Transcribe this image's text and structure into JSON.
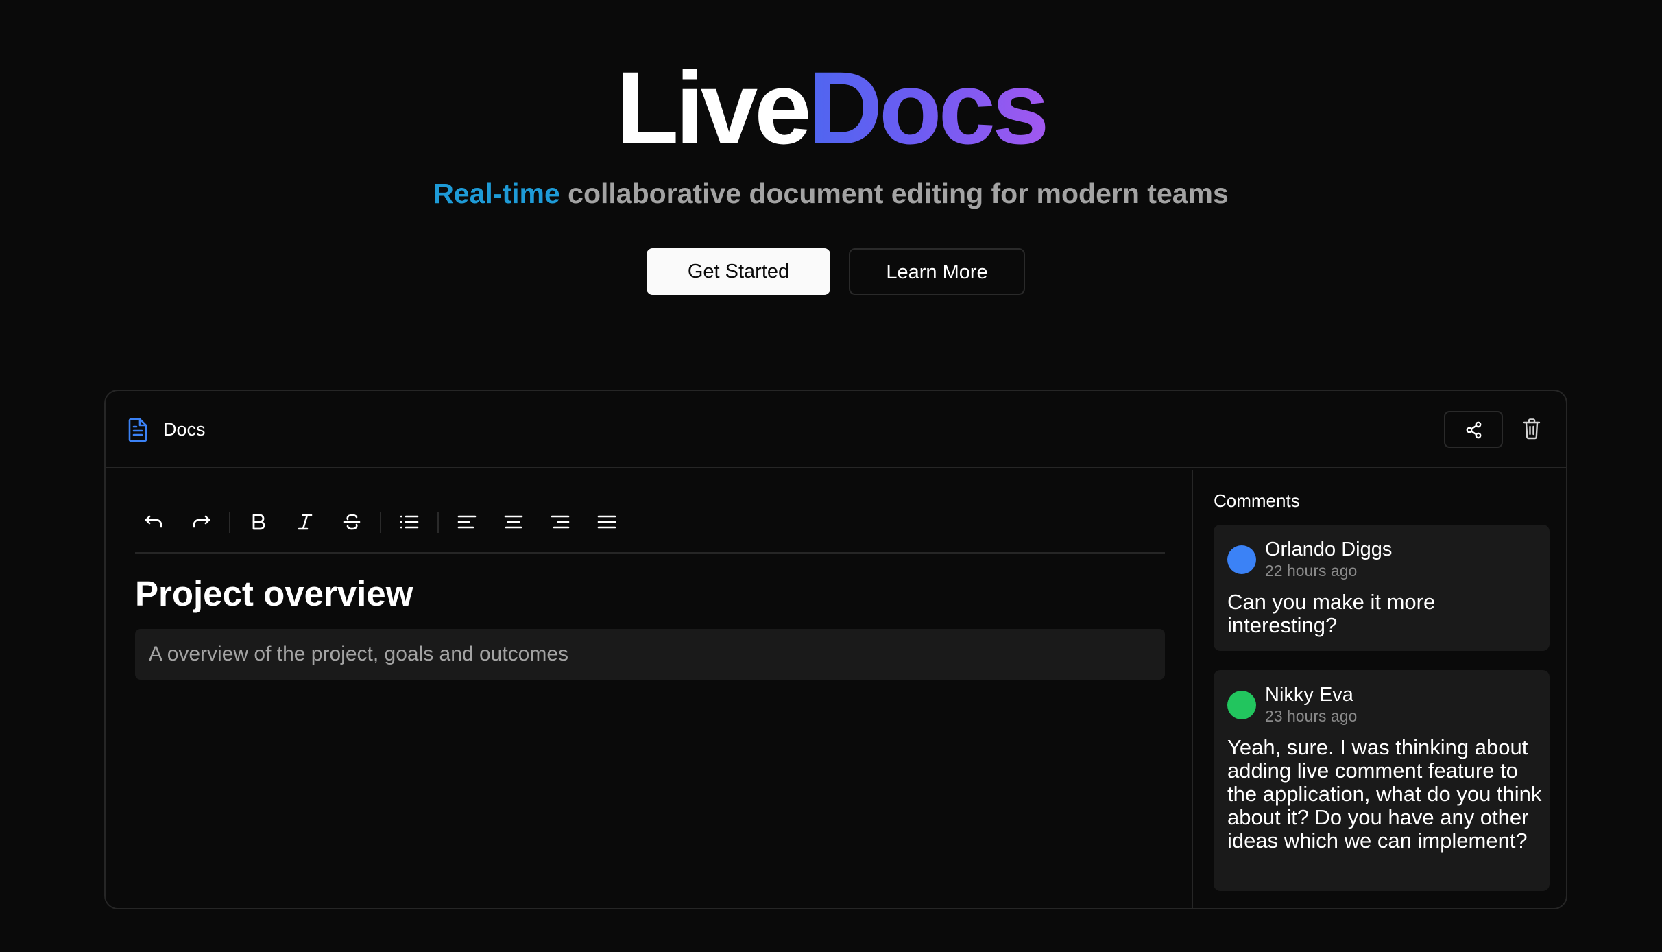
{
  "hero": {
    "brand_part1": "Live",
    "brand_part2": "Docs",
    "tagline_accent": "Real-time",
    "tagline_rest": " collaborative document editing for modern teams",
    "primary_button": "Get Started",
    "secondary_button": "Learn More"
  },
  "panel": {
    "title": "Docs",
    "icons": {
      "doc": "file-text-icon",
      "share": "share-icon",
      "delete": "trash-icon"
    }
  },
  "toolbar": {
    "tools": [
      "undo",
      "redo",
      "bold",
      "italic",
      "strikethrough",
      "bullet-list",
      "align-left",
      "align-center",
      "align-right",
      "align-justify"
    ]
  },
  "document": {
    "heading": "Project overview",
    "placeholder": "A overview of the project, goals and outcomes"
  },
  "comments": {
    "title": "Comments",
    "items": [
      {
        "author": "Orlando Diggs",
        "time": "22 hours ago",
        "text": "Can you make it more interesting?",
        "avatar_color": "#3b82f6"
      },
      {
        "author": "Nikky Eva",
        "time": "23 hours ago",
        "text": "Yeah, sure. I was thinking about adding live comment feature to the application, what do you think about it? Do you have any other ideas which we can implement?",
        "avatar_color": "#22c55e"
      }
    ]
  },
  "colors": {
    "background": "#0a0a0a",
    "accent_blue": "#1e9bd7",
    "gradient_start": "#4f66f0",
    "gradient_end": "#a158f0",
    "card": "#1a1a1a",
    "border": "#262626"
  }
}
